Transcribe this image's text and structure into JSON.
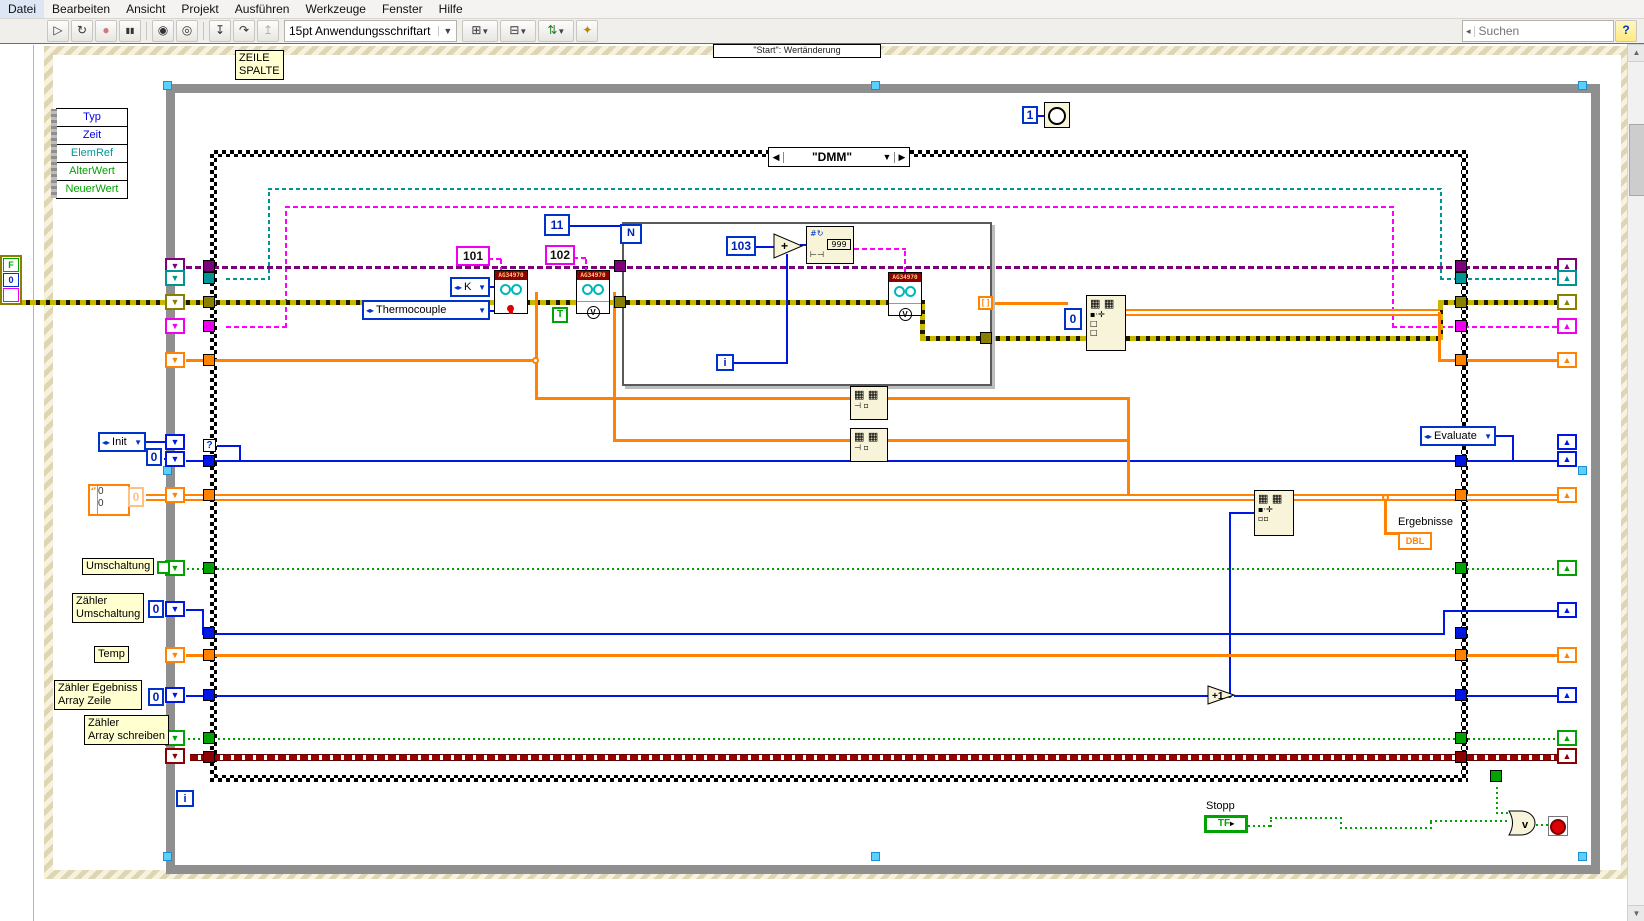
{
  "menubar": {
    "items": [
      "Datei",
      "Bearbeiten",
      "Ansicht",
      "Projekt",
      "Ausführen",
      "Werkzeuge",
      "Fenster",
      "Hilfe"
    ]
  },
  "toolbar": {
    "font_selector": "15pt Anwendungsschriftart",
    "search_placeholder": "Suchen",
    "help_label": "?",
    "icons": {
      "run": "▷",
      "run_continuous": "↻",
      "abort": "●",
      "pause": "▮▮",
      "highlight": "◉",
      "retain": "◎",
      "step_into": "↧",
      "step_over": "↷",
      "step_out": "↥",
      "align": "⊞",
      "distribute": "⊟",
      "reorder": "⇅",
      "cleanup": "✦",
      "dropdown": "▼",
      "search_scope": "◂"
    }
  },
  "canvas": {
    "clipped_event_label": "\"Start\": Wertänderung",
    "event_node": {
      "rows": [
        {
          "label": "Typ",
          "color": "#0000ee"
        },
        {
          "label": "Zeit",
          "color": "#0000ee"
        },
        {
          "label": "ElemRef",
          "color": "#009999"
        },
        {
          "label": "AlterWert",
          "color": "#00a300"
        },
        {
          "label": "NeuerWert",
          "color": "#00a300"
        }
      ]
    },
    "case": {
      "selector": "\"DMM\"",
      "left_arrow": "◀",
      "right_arrow": "▶",
      "dropdown": "▼"
    },
    "for_loop": {
      "count": "N",
      "iteration": "i"
    },
    "while_loop": {
      "iteration": "i"
    },
    "labels": {
      "zeile": "ZEILE\nSPALTE",
      "umschaltung": "Umschaltung",
      "zaehler_umschaltung": "Zähler\nUmschaltung",
      "temp": "Temp",
      "zaehler_egebniss": "Zähler Egebniss\nArray Zeile",
      "zaehler_array": "Zähler\nArray schreiben",
      "stopp": "Stopp",
      "ergebnisse": "Ergebnisse"
    },
    "constants": {
      "c101": "101",
      "c102": "102",
      "c11": "11",
      "c103": "103",
      "c1": "1",
      "c0": "0",
      "k": "K",
      "thermocouple": "Thermocouple",
      "init": "Init",
      "evaluate": "Evaluate",
      "t": "T",
      "f": "F",
      "tf": "TF"
    },
    "nodes": {
      "ag_header": "AG34970",
      "fmt_hash": "#↻",
      "fmt_999": "999",
      "fmt_range": "⊢⊣",
      "grid2": "▦ ▦",
      "grid_idx": "⊣ ▫",
      "grid_rep": "▪·✛",
      "add": "+",
      "inc": "+1",
      "or": "v",
      "dbl": "DBL",
      "sr_down": "▼",
      "sr_up": "▲",
      "index_bracket": "[ ]"
    }
  },
  "colors": {
    "wire_orange": "#ff8200",
    "wire_blue": "#0017e4",
    "wire_pink": "#ff00ff",
    "wire_purple": "#7d007d",
    "wire_teal": "#009494",
    "wire_green": "#00a300",
    "wire_error_yellow": "#c9b700",
    "wire_dark_red": "#9c0000",
    "label_bg": "#ffffd0",
    "selection_handle": "#5ad0ff",
    "structure_gray": "#8f8f8f",
    "ag_header_red": "#8c0000"
  }
}
